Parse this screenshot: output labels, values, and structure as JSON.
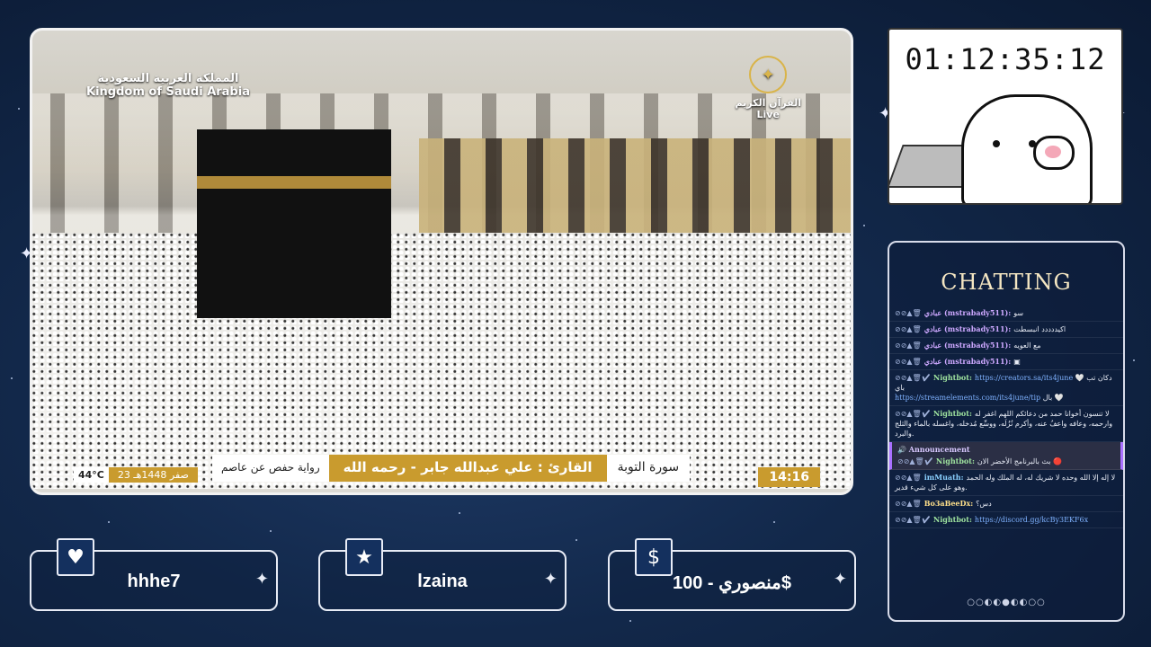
{
  "video": {
    "watermark_arabic": "المملكة العربية السعودية",
    "watermark_english": "Kingdom of Saudi Arabia",
    "channel_name": "القرآن الكريم",
    "live_label": "Live",
    "surah": "سورة التوبة",
    "reader": "القارئ : علي عبدالله جابر - رحمه الله",
    "riwaya": "رواية حفص عن عاصم",
    "hijri_date": "23 صفر 1448هـ",
    "temperature": "44°C",
    "clock": "14:16"
  },
  "timer": {
    "value": "01:12:35:12"
  },
  "chat": {
    "title": "CHATTING",
    "announcement_label": "Announcement",
    "messages": [
      {
        "user": "عبادي (mstrabady511):",
        "text": "سو"
      },
      {
        "user": "عبادي (mstrabady511):",
        "text": "اكيددددد انبسطت"
      },
      {
        "user": "عبادي (mstrabady511):",
        "text": "مع العويه"
      },
      {
        "user": "عبادي (mstrabady511):",
        "text": ""
      },
      {
        "user": "Nightbot:",
        "text": "دكان تب 🤍 باي",
        "link": "https://creators.sa/its4june",
        "text2": "بال 🤍",
        "link2": "https://streamelements.com/its4june/tip"
      },
      {
        "user": "Nightbot:",
        "text": "لا تنسون أخوانا حمد من دعائكم اللهم اغفر له وارحمه، وعافه واعفُ عنه، وأكرم نُزُلَه، ووسِّع مُدخله، واغسله بالماء والثلج والبرد."
      },
      {
        "user": "Nightbot:",
        "text": "بث بالبرنامج الأخضر الان 🔴"
      },
      {
        "user": "imMuath:",
        "text": "لا إله إلا الله وحده لا شريك له، له الملك وله الحمد وهو على كل شيء قدير."
      },
      {
        "user": "Bo3aBeeDx:",
        "text": "دس؟"
      },
      {
        "user": "Nightbot:",
        "text": "",
        "link": "https://discord.gg/kcBy3EKF6x"
      }
    ],
    "pager": "○○◐◐●◐◐○○"
  },
  "alerts": {
    "follower": "hhhe7",
    "subscriber": "lzaina",
    "donation": "منصوري - 100$"
  },
  "icons": {
    "follower": "heart-icon",
    "subscriber": "star-icon",
    "donation": "dollar-icon"
  },
  "colors": {
    "gold": "#c99b2e",
    "background": "#12284a",
    "title": "#f4e6c2"
  }
}
